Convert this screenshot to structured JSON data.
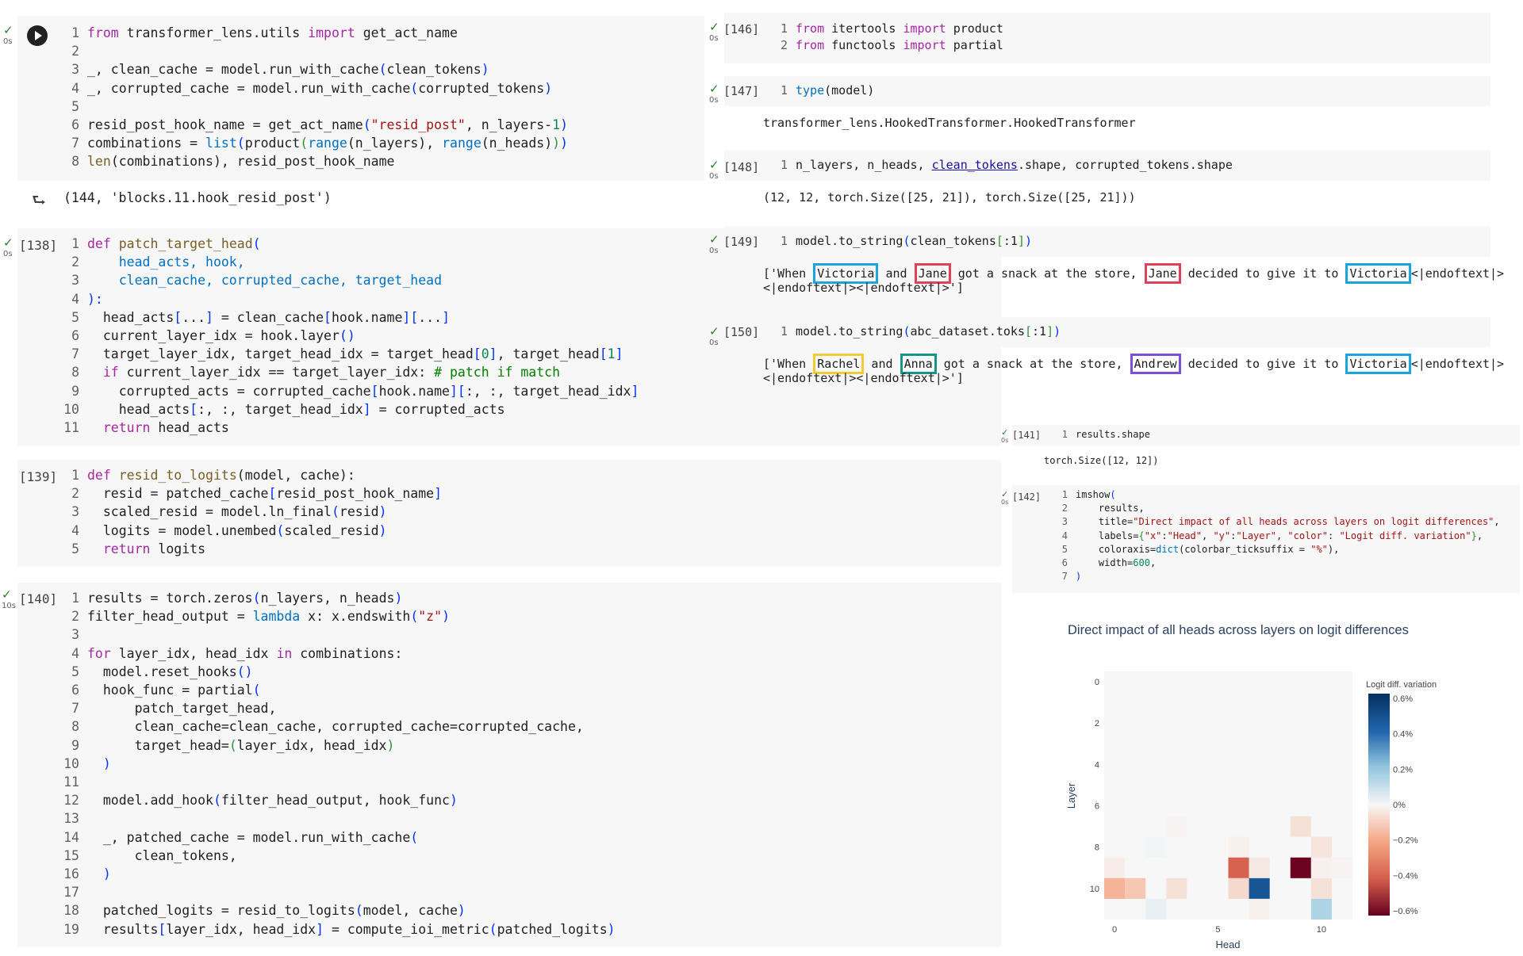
{
  "cells": {
    "c_top": {
      "duration": "0s",
      "lines": [
        [
          [
            "from ",
            "kw"
          ],
          [
            "transformer_lens.utils ",
            ""
          ],
          [
            "import ",
            "kw"
          ],
          [
            "get_act_name",
            ""
          ]
        ],
        [],
        [
          [
            "_, clean_cache = model.run_with_cache",
            ""
          ],
          [
            "(",
            "pr"
          ],
          [
            "clean_tokens",
            ""
          ],
          [
            ")",
            "pr"
          ]
        ],
        [
          [
            "_, corrupted_cache = model.run_with_cache",
            ""
          ],
          [
            "(",
            "pr"
          ],
          [
            "corrupted_tokens",
            ""
          ],
          [
            ")",
            "pr"
          ]
        ],
        [],
        [
          [
            "resid_post_hook_name = get_act_name",
            ""
          ],
          [
            "(",
            "pr"
          ],
          [
            "\"resid_post\"",
            "str"
          ],
          [
            ", n_layers-",
            ""
          ],
          [
            "1",
            "num"
          ],
          [
            ")",
            "pr"
          ]
        ],
        [
          [
            "combinations = ",
            ""
          ],
          [
            "list",
            "bi"
          ],
          [
            "(",
            "pr"
          ],
          [
            "product",
            ""
          ],
          [
            "(",
            "pr2"
          ],
          [
            "range",
            "bi"
          ],
          [
            "(n_layers), ",
            ""
          ],
          [
            "range",
            "bi"
          ],
          [
            "(n_heads)",
            ""
          ],
          [
            ")",
            "pr2"
          ],
          [
            ")",
            "pr"
          ]
        ],
        [
          [
            "len",
            "fn"
          ],
          [
            "(combinations), resid_post_hook_name",
            ""
          ]
        ]
      ],
      "output": "(144, 'blocks.11.hook_resid_post')"
    },
    "c138": {
      "count": "[138]",
      "duration": "0s",
      "lines": [
        [
          [
            "def ",
            "kw"
          ],
          [
            "patch_target_head",
            "fn"
          ],
          [
            "(",
            "pr"
          ]
        ],
        [
          [
            "    head_acts, hook,",
            "bi"
          ]
        ],
        [
          [
            "    clean_cache, corrupted_cache, target_head",
            "bi"
          ]
        ],
        [
          [
            "):",
            "pr"
          ]
        ],
        [
          [
            "  head_acts",
            ""
          ],
          [
            "[",
            "pr"
          ],
          [
            "...",
            ""
          ],
          [
            "]",
            "pr"
          ],
          [
            " = clean_cache",
            ""
          ],
          [
            "[",
            "pr"
          ],
          [
            "hook.name",
            ""
          ],
          [
            "][",
            "pr"
          ],
          [
            "...",
            ""
          ],
          [
            "]",
            "pr"
          ]
        ],
        [
          [
            "  current_layer_idx = hook.layer",
            ""
          ],
          [
            "()",
            "pr"
          ]
        ],
        [
          [
            "  target_layer_idx, target_head_idx = target_head",
            ""
          ],
          [
            "[",
            "pr"
          ],
          [
            "0",
            "num"
          ],
          [
            "]",
            "pr"
          ],
          [
            ", target_head",
            ""
          ],
          [
            "[",
            "pr"
          ],
          [
            "1",
            "num"
          ],
          [
            "]",
            "pr"
          ]
        ],
        [
          [
            "  if ",
            "kw"
          ],
          [
            "current_layer_idx == target_layer_idx: ",
            ""
          ],
          [
            "# patch if match",
            "cmt"
          ]
        ],
        [
          [
            "    corrupted_acts = corrupted_cache",
            ""
          ],
          [
            "[",
            "pr"
          ],
          [
            "hook.name",
            ""
          ],
          [
            "][",
            "pr"
          ],
          [
            ":, :, target_head_idx",
            ""
          ],
          [
            "]",
            "pr"
          ]
        ],
        [
          [
            "    head_acts",
            ""
          ],
          [
            "[",
            "pr"
          ],
          [
            ":, :, target_head_idx",
            ""
          ],
          [
            "]",
            "pr"
          ],
          [
            " = corrupted_acts",
            ""
          ]
        ],
        [
          [
            "  return ",
            "kw"
          ],
          [
            "head_acts",
            ""
          ]
        ]
      ]
    },
    "c139": {
      "count": "[139]",
      "lines": [
        [
          [
            "def ",
            "kw"
          ],
          [
            "resid_to_logits",
            "fn"
          ],
          [
            "(model, cache):",
            ""
          ]
        ],
        [
          [
            "  resid = patched_cache",
            ""
          ],
          [
            "[",
            "pr"
          ],
          [
            "resid_post_hook_name",
            ""
          ],
          [
            "]",
            "pr"
          ]
        ],
        [
          [
            "  scaled_resid = model.ln_final",
            ""
          ],
          [
            "(",
            "pr"
          ],
          [
            "resid",
            ""
          ],
          [
            ")",
            "pr"
          ]
        ],
        [
          [
            "  logits = model.unembed",
            ""
          ],
          [
            "(",
            "pr"
          ],
          [
            "scaled_resid",
            ""
          ],
          [
            ")",
            "pr"
          ]
        ],
        [
          [
            "  return ",
            "kw"
          ],
          [
            "logits",
            ""
          ]
        ]
      ]
    },
    "c140": {
      "count": "[140]",
      "duration": "10s",
      "lines": [
        [
          [
            "results = torch.zeros",
            ""
          ],
          [
            "(",
            "pr"
          ],
          [
            "n_layers, n_heads",
            ""
          ],
          [
            ")",
            "pr"
          ]
        ],
        [
          [
            "filter_head_output = ",
            ""
          ],
          [
            "lambda ",
            "bi"
          ],
          [
            "x: x.endswith",
            ""
          ],
          [
            "(",
            "pr"
          ],
          [
            "\"z\"",
            "str"
          ],
          [
            ")",
            "pr"
          ]
        ],
        [],
        [
          [
            "for ",
            "kw"
          ],
          [
            "layer_idx, head_idx ",
            ""
          ],
          [
            "in ",
            "kw"
          ],
          [
            "combinations:",
            ""
          ]
        ],
        [
          [
            "  model.reset_hooks",
            ""
          ],
          [
            "()",
            "pr"
          ]
        ],
        [
          [
            "  hook_func = partial",
            ""
          ],
          [
            "(",
            "pr"
          ]
        ],
        [
          [
            "      patch_target_head,",
            ""
          ]
        ],
        [
          [
            "      clean_cache=clean_cache, corrupted_cache=corrupted_cache,",
            ""
          ]
        ],
        [
          [
            "      target_head=",
            ""
          ],
          [
            "(",
            "pr2"
          ],
          [
            "layer_idx, head_idx",
            ""
          ],
          [
            ")",
            "pr2"
          ]
        ],
        [
          [
            "  )",
            "pr"
          ]
        ],
        [],
        [
          [
            "  model.add_hook",
            ""
          ],
          [
            "(",
            "pr"
          ],
          [
            "filter_head_output, hook_func",
            ""
          ],
          [
            ")",
            "pr"
          ]
        ],
        [],
        [
          [
            "  _, patched_cache = model.run_with_cache",
            ""
          ],
          [
            "(",
            "pr"
          ]
        ],
        [
          [
            "      clean_tokens,",
            ""
          ]
        ],
        [
          [
            "  )",
            "pr"
          ]
        ],
        [],
        [
          [
            "  patched_logits = resid_to_logits",
            ""
          ],
          [
            "(",
            "pr"
          ],
          [
            "model, cache",
            ""
          ],
          [
            ")",
            "pr"
          ]
        ],
        [
          [
            "  results",
            ""
          ],
          [
            "[",
            "pr"
          ],
          [
            "layer_idx, head_idx",
            ""
          ],
          [
            "]",
            "pr"
          ],
          [
            " = compute_ioi_metric",
            ""
          ],
          [
            "(",
            "pr"
          ],
          [
            "patched_logits",
            ""
          ],
          [
            ")",
            "pr"
          ]
        ]
      ]
    },
    "c146": {
      "count": "[146]",
      "duration": "0s",
      "lines": [
        [
          [
            "from ",
            "kw"
          ],
          [
            "itertools ",
            ""
          ],
          [
            "import ",
            "kw"
          ],
          [
            "product",
            ""
          ]
        ],
        [
          [
            "from ",
            "kw"
          ],
          [
            "functools ",
            ""
          ],
          [
            "import ",
            "kw"
          ],
          [
            "partial",
            ""
          ]
        ]
      ]
    },
    "c147": {
      "count": "[147]",
      "duration": "0s",
      "lines": [
        [
          [
            "type",
            "bi"
          ],
          [
            "(model)",
            ""
          ]
        ]
      ],
      "output": "transformer_lens.HookedTransformer.HookedTransformer"
    },
    "c148": {
      "count": "[148]",
      "duration": "0s",
      "lines": [
        [
          [
            "n_layers, n_heads, ",
            ""
          ],
          [
            "clean_tokens",
            "u"
          ],
          [
            ".shape, corrupted_tokens.shape",
            ""
          ]
        ]
      ],
      "output": "(12, 12, torch.Size([25, 21]), torch.Size([25, 21]))"
    },
    "c149": {
      "count": "[149]",
      "duration": "0s",
      "lines": [
        [
          [
            "model.to_string",
            ""
          ],
          [
            "(",
            "pr"
          ],
          [
            "clean_tokens",
            ""
          ],
          [
            "[",
            "pr2"
          ],
          [
            ":1",
            ""
          ],
          [
            "]",
            "pr2"
          ],
          [
            ")",
            "pr"
          ]
        ]
      ],
      "output_line1": [
        [
          "['When ",
          ""
        ],
        [
          "Victoria",
          "blue"
        ],
        [
          " and ",
          ""
        ],
        [
          "Jane",
          "red"
        ],
        [
          " got a snack at the store, ",
          ""
        ],
        [
          "Jane",
          "red"
        ],
        [
          " decided to give it to ",
          ""
        ],
        [
          "Victoria",
          "blue"
        ],
        [
          "<|endoftext|>",
          ""
        ]
      ],
      "output_line2": "<|endoftext|><|endoftext|>']"
    },
    "c150": {
      "count": "[150]",
      "duration": "0s",
      "lines": [
        [
          [
            "model.to_string",
            ""
          ],
          [
            "(",
            "pr"
          ],
          [
            "abc_dataset.toks",
            ""
          ],
          [
            "[",
            "pr2"
          ],
          [
            ":1",
            ""
          ],
          [
            "]",
            "pr2"
          ],
          [
            ")",
            "pr"
          ]
        ]
      ],
      "output_line1": [
        [
          "['When ",
          ""
        ],
        [
          "Rachel",
          "yellow"
        ],
        [
          " and ",
          ""
        ],
        [
          "Anna",
          "teal"
        ],
        [
          " got a snack at the store, ",
          ""
        ],
        [
          "Andrew",
          "purple"
        ],
        [
          " decided to give it to ",
          ""
        ],
        [
          "Victoria",
          "blue"
        ],
        [
          "<|endoftext|>",
          ""
        ]
      ],
      "output_line2": "<|endoftext|><|endoftext|>']"
    },
    "c141": {
      "count": "[141]",
      "duration": "0s",
      "lines": [
        [
          [
            "results.shape",
            ""
          ]
        ]
      ],
      "output": "torch.Size([12, 12])"
    },
    "c142": {
      "count": "[142]",
      "duration": "0s",
      "lines": [
        [
          [
            "imshow",
            ""
          ],
          [
            "(",
            "pr"
          ]
        ],
        [
          [
            "    results,",
            ""
          ]
        ],
        [
          [
            "    title=",
            ""
          ],
          [
            "\"Direct impact of all heads across layers on logit differences\"",
            "str"
          ],
          [
            ",",
            ""
          ]
        ],
        [
          [
            "    labels=",
            ""
          ],
          [
            "{",
            "pr2"
          ],
          [
            "\"x\"",
            "str"
          ],
          [
            ":",
            ""
          ],
          [
            "\"Head\"",
            "str"
          ],
          [
            ", ",
            ""
          ],
          [
            "\"y\"",
            "str"
          ],
          [
            ":",
            ""
          ],
          [
            "\"Layer\"",
            "str"
          ],
          [
            ", ",
            ""
          ],
          [
            "\"color\"",
            "str"
          ],
          [
            ": ",
            ""
          ],
          [
            "\"Logit diff. variation\"",
            "str"
          ],
          [
            "}",
            "pr2"
          ],
          [
            ",",
            ""
          ]
        ],
        [
          [
            "    coloraxis=",
            ""
          ],
          [
            "dict",
            "bi"
          ],
          [
            "(colorbar_ticksuffix = ",
            ""
          ],
          [
            "\"%\"",
            "str"
          ],
          [
            "),",
            ""
          ]
        ],
        [
          [
            "    width=",
            ""
          ],
          [
            "600",
            "num"
          ],
          [
            ",",
            ""
          ]
        ],
        [
          [
            ")",
            "pr"
          ]
        ]
      ]
    }
  },
  "chart_data": {
    "type": "heatmap",
    "title": "Direct impact of all heads across layers on logit differences",
    "xlabel": "Head",
    "ylabel": "Layer",
    "colorbar_title": "Logit diff. variation",
    "colorbar_ticks": [
      "0.6%",
      "0.4%",
      "0.2%",
      "0%",
      "−0.2%",
      "−0.4%",
      "−0.6%"
    ],
    "x_ticks": [
      "0",
      "5",
      "10"
    ],
    "y_ticks": [
      "0",
      "2",
      "4",
      "6",
      "8",
      "10"
    ],
    "zrange": [
      -0.65,
      0.65
    ],
    "cells": [
      {
        "layer": 7,
        "head": 3,
        "value": -0.01
      },
      {
        "layer": 7,
        "head": 9,
        "value": -0.06
      },
      {
        "layer": 8,
        "head": 2,
        "value": 0.01
      },
      {
        "layer": 8,
        "head": 6,
        "value": -0.02
      },
      {
        "layer": 8,
        "head": 10,
        "value": -0.05
      },
      {
        "layer": 9,
        "head": 0,
        "value": -0.03
      },
      {
        "layer": 9,
        "head": 6,
        "value": -0.42
      },
      {
        "layer": 9,
        "head": 7,
        "value": -0.04
      },
      {
        "layer": 9,
        "head": 9,
        "value": -0.64
      },
      {
        "layer": 9,
        "head": 10,
        "value": -0.02
      },
      {
        "layer": 9,
        "head": 11,
        "value": -0.01
      },
      {
        "layer": 10,
        "head": 0,
        "value": -0.18
      },
      {
        "layer": 10,
        "head": 1,
        "value": -0.13
      },
      {
        "layer": 10,
        "head": 3,
        "value": -0.06
      },
      {
        "layer": 10,
        "head": 6,
        "value": -0.08
      },
      {
        "layer": 10,
        "head": 7,
        "value": 0.5
      },
      {
        "layer": 10,
        "head": 10,
        "value": -0.06
      },
      {
        "layer": 11,
        "head": 2,
        "value": 0.03
      },
      {
        "layer": 11,
        "head": 7,
        "value": -0.02
      },
      {
        "layer": 11,
        "head": 10,
        "value": 0.16
      }
    ]
  }
}
